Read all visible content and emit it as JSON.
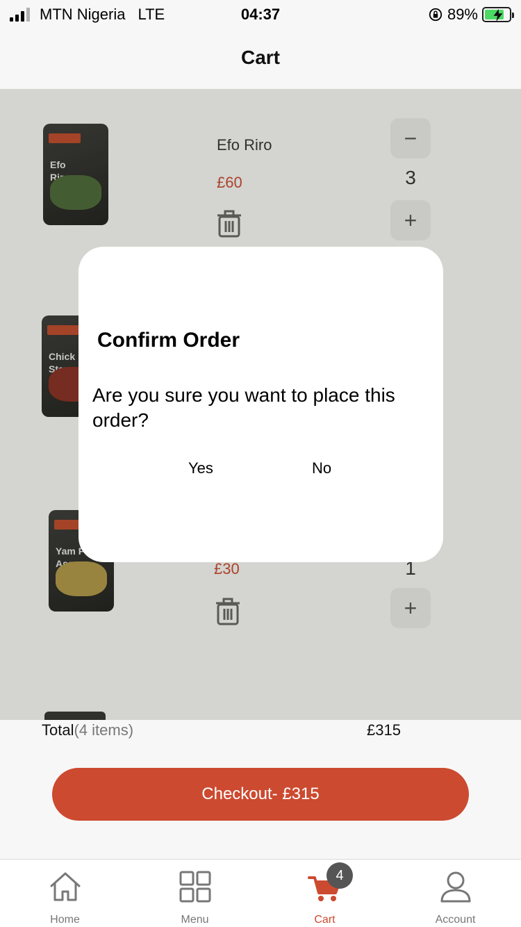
{
  "status_bar": {
    "carrier": "MTN Nigeria",
    "network": "LTE",
    "time": "04:37",
    "battery": "89%"
  },
  "header": {
    "title": "Cart"
  },
  "cart_items": [
    {
      "name": "Efo Riro",
      "price": "£60",
      "qty": "3",
      "pack_label": "Efo\nRiro"
    },
    {
      "name": "",
      "price": "",
      "qty": "",
      "pack_label": "Chick\nStew"
    },
    {
      "name": "",
      "price": "£30",
      "qty": "1",
      "pack_label": "Yam Porridge\nAsaro"
    }
  ],
  "dialog": {
    "title": "Confirm Order",
    "message": "Are you sure you want to place this order?",
    "yes_label": "Yes",
    "no_label": "No"
  },
  "summary": {
    "total_label": "Total",
    "items_count": "(4 items)",
    "total_value": "£315",
    "checkout_label": "Checkout- £315"
  },
  "tabs": [
    {
      "label": "Home",
      "icon": "home-icon"
    },
    {
      "label": "Menu",
      "icon": "grid-icon"
    },
    {
      "label": "Cart",
      "icon": "cart-icon",
      "badge": "4",
      "active": true
    },
    {
      "label": "Account",
      "icon": "user-icon"
    }
  ],
  "colors": {
    "accent": "#cc4a30",
    "overlay": "rgba(40,40,20,0.2)",
    "badge": "#555555"
  }
}
